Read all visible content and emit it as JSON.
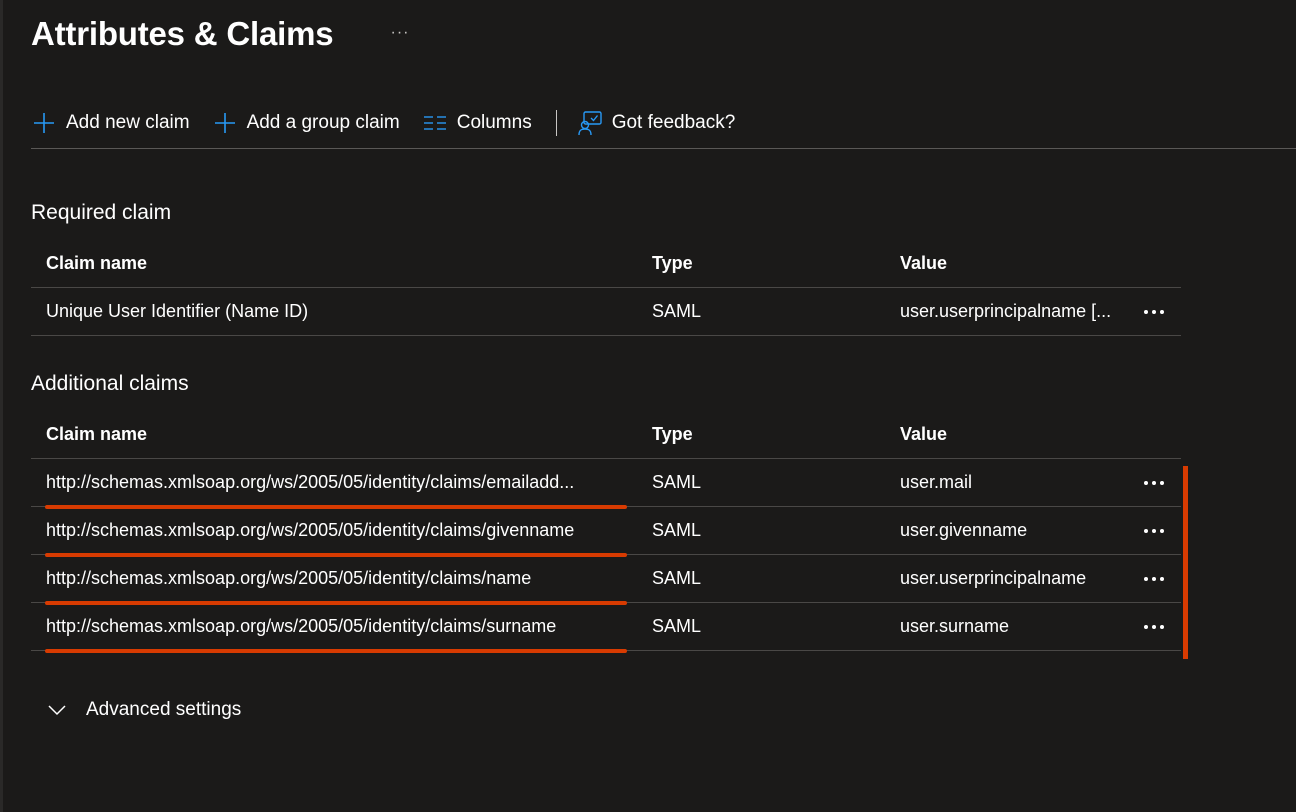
{
  "header": {
    "title": "Attributes & Claims",
    "more_label": "···"
  },
  "toolbar": {
    "add_claim_label": "Add new claim",
    "add_group_claim_label": "Add a group claim",
    "columns_label": "Columns",
    "feedback_label": "Got feedback?"
  },
  "required": {
    "title": "Required claim",
    "headers": {
      "name": "Claim name",
      "type": "Type",
      "value": "Value"
    },
    "rows": [
      {
        "name": "Unique User Identifier (Name ID)",
        "type": "SAML",
        "value": "user.userprincipalname [..."
      }
    ]
  },
  "additional": {
    "title": "Additional claims",
    "headers": {
      "name": "Claim name",
      "type": "Type",
      "value": "Value"
    },
    "rows": [
      {
        "name": "http://schemas.xmlsoap.org/ws/2005/05/identity/claims/emailadd...",
        "type": "SAML",
        "value": "user.mail"
      },
      {
        "name": "http://schemas.xmlsoap.org/ws/2005/05/identity/claims/givenname",
        "type": "SAML",
        "value": "user.givenname"
      },
      {
        "name": "http://schemas.xmlsoap.org/ws/2005/05/identity/claims/name",
        "type": "SAML",
        "value": "user.userprincipalname"
      },
      {
        "name": "http://schemas.xmlsoap.org/ws/2005/05/identity/claims/surname",
        "type": "SAML",
        "value": "user.surname"
      }
    ]
  },
  "advanced": {
    "label": "Advanced settings"
  },
  "colors": {
    "background": "#1b1a19",
    "accent_blue": "#2899f5",
    "highlight_red": "#d83b01",
    "divider": "#4a4846"
  },
  "icons": {
    "add": "plus-icon",
    "columns": "columns-icon",
    "feedback": "feedback-icon",
    "row_more": "more-icon",
    "expand": "chevron-down-icon"
  }
}
